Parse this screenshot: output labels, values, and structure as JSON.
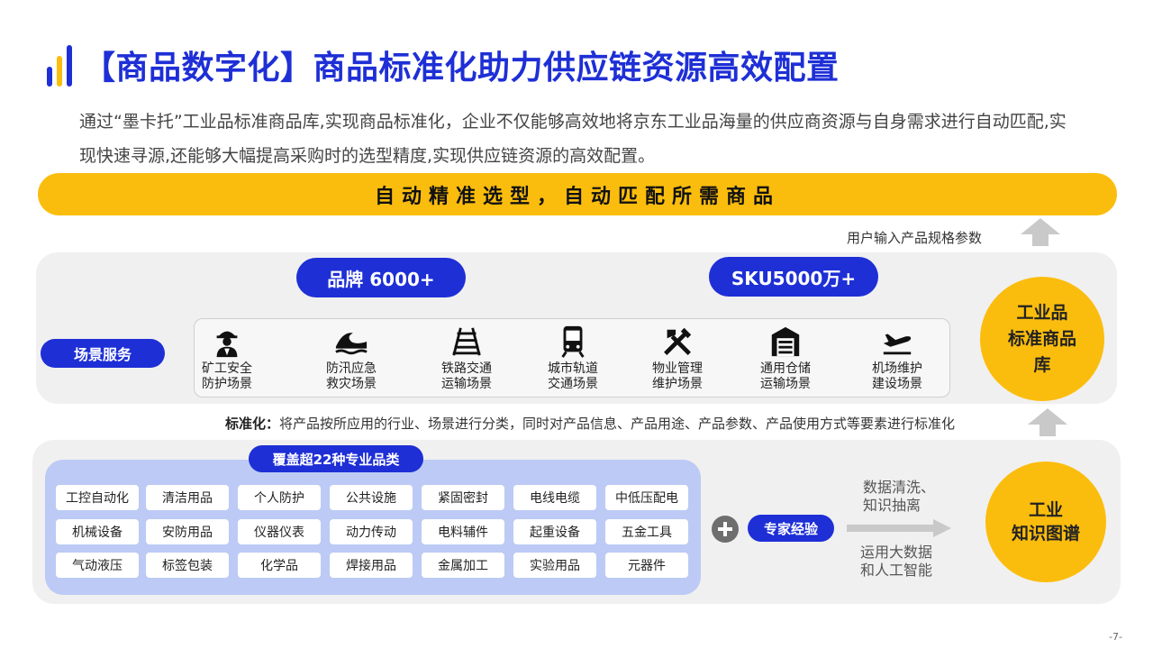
{
  "header": {
    "title": "【商品数字化】商品标准化助力供应链资源高效配置",
    "intro": "通过“墨卡托”工业品标准商品库,实现商品标准化，企业不仅能够高效地将京东工业品海量的供应商资源与自身需求进行自动匹配,实现快速寻源,还能够大幅提高采购时的选型精度,实现供应链资源的高效配置。"
  },
  "banner": {
    "text": "自动精准选型，自动匹配所需商品"
  },
  "user_input_label": "用户输入产品规格参数",
  "stats": {
    "brand": "品牌 6000+",
    "sku": "SKU5000万+"
  },
  "scene_label": "场景服务",
  "scenes": [
    {
      "line1": "矿工安全",
      "line2": "防护场景",
      "icon": "miner-icon"
    },
    {
      "line1": "防汛应急",
      "line2": "救灾场景",
      "icon": "wave-icon"
    },
    {
      "line1": "铁路交通",
      "line2": "运输场景",
      "icon": "railway-icon"
    },
    {
      "line1": "城市轨道",
      "line2": "交通场景",
      "icon": "metro-train-icon"
    },
    {
      "line1": "物业管理",
      "line2": "维护场景",
      "icon": "tools-icon"
    },
    {
      "line1": "通用仓储",
      "line2": "运输场景",
      "icon": "warehouse-icon"
    },
    {
      "line1": "机场维护",
      "line2": "建设场景",
      "icon": "airplane-icon"
    }
  ],
  "library_circle": {
    "line1": "工业品",
    "line2": "标准商品",
    "line3": "库"
  },
  "standardization": {
    "label": "标准化：",
    "text": "将产品按所应用的行业、场景进行分类，同时对产品信息、产品用途、产品参数、产品使用方式等要素进行标准化"
  },
  "categories_title": "覆盖超22种专业品类",
  "categories": [
    [
      "工控自动化",
      "清洁用品",
      "个人防护",
      "公共设施",
      "紧固密封",
      "电线电缆",
      "中低压配电"
    ],
    [
      "机械设备",
      "安防用品",
      "仪器仪表",
      "动力传动",
      "电料辅件",
      "起重设备",
      "五金工具"
    ],
    [
      "气动液压",
      "标签包装",
      "化学品",
      "焊接用品",
      "金属加工",
      "实验用品",
      "元器件"
    ]
  ],
  "expert_label": "专家经验",
  "process": {
    "top_line1": "数据清洗、",
    "top_line2": "知识抽离",
    "bottom_line1": "运用大数据",
    "bottom_line2": "和人工智能"
  },
  "knowledge_circle": {
    "line1": "工业",
    "line2": "知识图谱"
  },
  "page_number": "-7-",
  "colors": {
    "brand_blue": "#1e2fd6",
    "accent_yellow": "#fbbd0d",
    "panel_gray": "#f0f0f0",
    "category_blue": "#bccaf5"
  }
}
